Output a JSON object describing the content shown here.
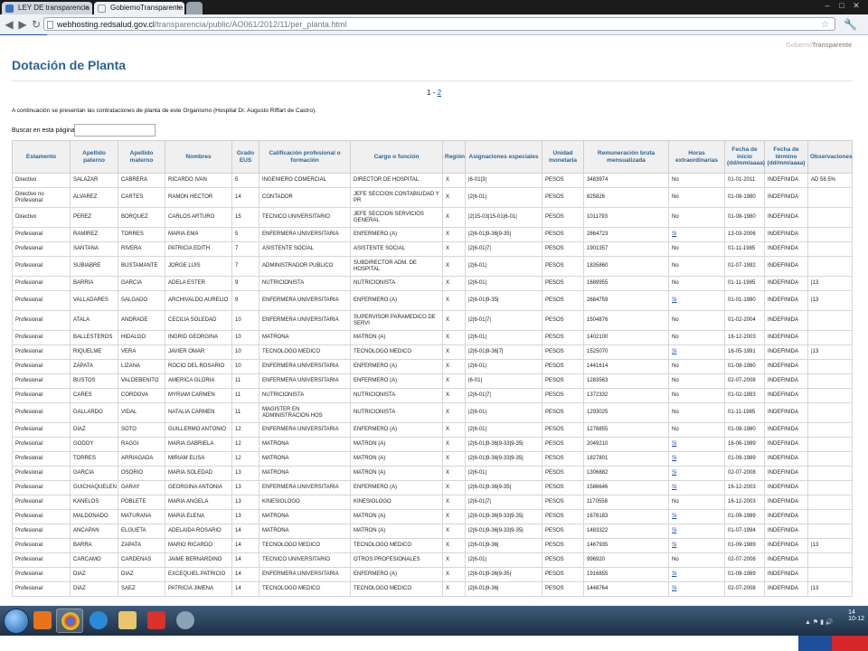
{
  "browser": {
    "tabs": [
      {
        "label": "LEY DE transparencia - Go"
      },
      {
        "label": "GobiernoTransparente - D"
      }
    ],
    "url_host": "webhosting.redsalud.gov.cl",
    "url_path": "/transparencia/public/AO061/2012/11/per_planta.html"
  },
  "page": {
    "brand_prefix": "Gobierno",
    "brand_suffix": "Transparente",
    "title": "Dotación de Planta",
    "pager_current": "1 - ",
    "pager_link": "2",
    "intro": "A continuación se presentan las contrataciones de planta de este Organismo (Hospital Dr. Augusto Riffart de Castro).",
    "search_label": "Buscar en esta página:",
    "search_value": ""
  },
  "table": {
    "headers": [
      "Estamento",
      "Apellido paterno",
      "Apellido materno",
      "Nombres",
      "Grado EUS",
      "Calificación profesional o formación",
      "Cargo o función",
      "Región",
      "Asignaciones especiales",
      "Unidad monetaria",
      "Remuneración bruta mensualizada",
      "Horas extraordinarias",
      "Fecha de inicio (dd/mm/aaaa)",
      "Fecha de término (dd/mm/aaaa)",
      "Observaciones"
    ],
    "rows": [
      [
        "Directivo",
        "SALAZAR",
        "CABRERA",
        "RICARDO IVAN",
        "5",
        "INGENIERO COMERCIAL",
        "DIRECTOR DE HOSPITAL",
        "X",
        "|6-01|3|",
        "PESOS",
        "3483974",
        "No",
        "01-01-2011",
        "INDEFINIDA",
        "AD 58.5%"
      ],
      [
        "Directivo no Profesional",
        "ALVAREZ",
        "CARTES",
        "RAMON HECTOR",
        "14",
        "CONTADOR",
        "JEFE SECCION CONTABILIDAD Y PR",
        "X",
        "|2|6-01|",
        "PESOS",
        "825826",
        "No",
        "01-08-1980",
        "INDEFINIDA",
        ""
      ],
      [
        "Directivo",
        "PEREZ",
        "BORQUEZ",
        "CARLOS ARTURO",
        "15",
        "TECNICO UNIVERSITARIO",
        "JEFE SECCION SERVICIOS GENERAL",
        "X",
        "|2|15-03|15-01|6-01|",
        "PESOS",
        "1011793",
        "No",
        "01-08-1980",
        "INDEFINIDA",
        ""
      ],
      [
        "Profesional",
        "RAMIREZ",
        "TORRES",
        "MARIA EMA",
        "5",
        "ENFERMERA UNIVERSITARIA",
        "ENFERMERO (A)",
        "X",
        "|2|6-01|9-36|9-35|",
        "PESOS",
        "2864723",
        "Si",
        "13-03-2006",
        "INDEFINIDA",
        ""
      ],
      [
        "Profesional",
        "SANTANA",
        "RIVERA",
        "PATRICIA EDITH",
        "7",
        "ASISTENTE SOCIAL",
        "ASISTENTE SOCIAL",
        "X",
        "|2|6-01|7|",
        "PESOS",
        "1901357",
        "No",
        "01-11-1985",
        "INDEFINIDA",
        ""
      ],
      [
        "Profesional",
        "SUBIABRE",
        "BUSTAMANTE",
        "JORGE LUIS",
        "7",
        "ADMINISTRADOR PUBLICO",
        "SUBDIRECTOR ADM. DE HOSPITAL",
        "X",
        "|2|6-01|",
        "PESOS",
        "1835860",
        "No",
        "01-07-1992",
        "INDEFINIDA",
        ""
      ],
      [
        "Profesional",
        "BARRIA",
        "GARCIA",
        "ADELA ESTER",
        "9",
        "NUTRICIONISTA",
        "NUTRICIONISTA",
        "X",
        "|2|6-01|",
        "PESOS",
        "1689955",
        "No",
        "01-11-1985",
        "INDEFINIDA",
        "|13"
      ],
      [
        "Profesional",
        "VALLADARES",
        "SALGADO",
        "ARCHIVALDO AURELIO",
        "9",
        "ENFERMERA UNIVERSITARIA",
        "ENFERMERO (A)",
        "X",
        "|2|6-01|9-35|",
        "PESOS",
        "2684759",
        "Si",
        "01-01-1980",
        "INDEFINIDA",
        "|13"
      ],
      [
        "Profesional",
        "ATALA",
        "ANDRADE",
        "CECILIA SOLEDAD",
        "10",
        "ENFERMERA UNIVERSITARIA",
        "SUPERVISOR PARAMEDICO DE SERVI",
        "X",
        "|2|6-01|7|",
        "PESOS",
        "1504876",
        "No",
        "01-02-2004",
        "INDEFINIDA",
        ""
      ],
      [
        "Profesional",
        "BALLESTEROS",
        "HIDALGO",
        "INGRID GEORGINA",
        "10",
        "MATRONA",
        "MATRON (A)",
        "X",
        "|2|6-01|",
        "PESOS",
        "1402100",
        "No",
        "16-12-2003",
        "INDEFINIDA",
        ""
      ],
      [
        "Profesional",
        "RIQUELME",
        "VERA",
        "JAVIER OMAR",
        "10",
        "TECNOLOGO MEDICO",
        "TECNOLOGO MEDICO",
        "X",
        "|2|6-01|9-36|7|",
        "PESOS",
        "1525070",
        "Si",
        "16-05-1991",
        "INDEFINIDA",
        "|13"
      ],
      [
        "Profesional",
        "ZAPATA",
        "LIZANA",
        "ROCIO DEL ROSARIO",
        "10",
        "ENFERMERA UNIVERSITARIA",
        "ENFERMERO (A)",
        "X",
        "|2|6-01|",
        "PESOS",
        "1441614",
        "No",
        "01-08-1980",
        "INDEFINIDA",
        ""
      ],
      [
        "Profesional",
        "BUSTOS",
        "VALDEBENITO",
        "AMERICA GLORIA",
        "11",
        "ENFERMERA UNIVERSITARIA",
        "ENFERMERO (A)",
        "X",
        "|6-01|",
        "PESOS",
        "1283563",
        "No",
        "02-07-2008",
        "INDEFINIDA",
        ""
      ],
      [
        "Profesional",
        "CARES",
        "CORDOVA",
        "MYRIAM CARMEN",
        "11",
        "NUTRICIONISTA",
        "NUTRICIONISTA",
        "X",
        "|2|6-01|7|",
        "PESOS",
        "1372332",
        "No",
        "01-02-1993",
        "INDEFINIDA",
        ""
      ],
      [
        "Profesional",
        "GALLARDO",
        "VIDAL",
        "NATALIA CARMEN",
        "11",
        "MAGISTER EN ADMINISTRACION HOS",
        "NUTRICIONISTA",
        "X",
        "|2|6-01|",
        "PESOS",
        "1293025",
        "No",
        "01-11-1985",
        "INDEFINIDA",
        ""
      ],
      [
        "Profesional",
        "DIAZ",
        "SOTO",
        "GUILLERMO ANTONIO",
        "12",
        "ENFERMERA UNIVERSITARIA",
        "ENFERMERO (A)",
        "X",
        "|2|6-01|",
        "PESOS",
        "1278855",
        "No",
        "01-08-1980",
        "INDEFINIDA",
        ""
      ],
      [
        "Profesional",
        "GODOY",
        "RAGGI",
        "MARIA GABRIELA",
        "12",
        "MATRONA",
        "MATRON (A)",
        "X",
        "|2|6-01|9-36|9-33|9-35|",
        "PESOS",
        "2049210",
        "Si",
        "16-06-1989",
        "INDEFINIDA",
        ""
      ],
      [
        "Profesional",
        "TORRES",
        "ARRIAGADA",
        "MIRIAM ELISA",
        "12",
        "MATRONA",
        "MATRON (A)",
        "X",
        "|2|6-01|9-36|9-33|9-35|",
        "PESOS",
        "1827801",
        "Si",
        "01-09-1989",
        "INDEFINIDA",
        ""
      ],
      [
        "Profesional",
        "GARCIA",
        "OSORIO",
        "MARIA SOLEDAD",
        "13",
        "MATRONA",
        "MATRON (A)",
        "X",
        "|2|6-01|",
        "PESOS",
        "1306882",
        "Si",
        "02-07-2008",
        "INDEFINIDA",
        ""
      ],
      [
        "Profesional",
        "GUICHAQUELEN",
        "GARAY",
        "GEORGINA ANTONIA",
        "13",
        "ENFERMERA UNIVERSITARIA",
        "ENFERMERO (A)",
        "X",
        "|2|6-01|9-36|9-35|",
        "PESOS",
        "1586646",
        "Si",
        "16-12-2003",
        "INDEFINIDA",
        ""
      ],
      [
        "Profesional",
        "KANELOS",
        "POBLETE",
        "MARIA ANGELA",
        "13",
        "KINESIOLOGO",
        "KINESIOLOGO",
        "X",
        "|2|6-01|7|",
        "PESOS",
        "1170558",
        "No",
        "16-12-2003",
        "INDEFINIDA",
        ""
      ],
      [
        "Profesional",
        "MALDONADO",
        "MATURANA",
        "MARIA ELENA",
        "13",
        "MATRONA",
        "MATRON (A)",
        "X",
        "|2|6-01|9-36|9-33|9-35|",
        "PESOS",
        "1678183",
        "Si",
        "01-09-1989",
        "INDEFINIDA",
        ""
      ],
      [
        "Profesional",
        "ANCAPAN",
        "ELGUETA",
        "ADELAIDA ROSARIO",
        "14",
        "MATRONA",
        "MATRON (A)",
        "X",
        "|2|6-01|9-36|9-33|9-35|",
        "PESOS",
        "1483322",
        "Si",
        "01-07-1994",
        "INDEFINIDA",
        ""
      ],
      [
        "Profesional",
        "BARRA",
        "ZAPATA",
        "MARIO RICARDO",
        "14",
        "TECNOLOGO MEDICO",
        "TECNOLOGO MEDICO",
        "X",
        "|2|6-01|9-36|",
        "PESOS",
        "1467935",
        "Si",
        "01-09-1989",
        "INDEFINIDA",
        "|13"
      ],
      [
        "Profesional",
        "CARCAMO",
        "CARDENAS",
        "JAIME BERNARDINO",
        "14",
        "TECNICO UNIVERSITARIO",
        "OTROS PROFESIONALES",
        "X",
        "|2|6-01|",
        "PESOS",
        "996920",
        "No",
        "02-07-2006",
        "INDEFINIDA",
        ""
      ],
      [
        "Profesional",
        "DIAZ",
        "DIAZ",
        "EXCEQUIEL PATRICIO",
        "14",
        "ENFERMERA UNIVERSITARIA",
        "ENFERMERO (A)",
        "X",
        "|2|6-01|9-36|9-35|",
        "PESOS",
        "1916855",
        "Si",
        "01-09-1989",
        "INDEFINIDA",
        ""
      ],
      [
        "Profesional",
        "DIAZ",
        "SAEZ",
        "PATRICIA JIMENA",
        "14",
        "TECNOLOGO MEDICO",
        "TECNOLOGO MEDICO",
        "X",
        "|2|6-01|9-36|",
        "PESOS",
        "1448764",
        "Si",
        "02-07-2008",
        "INDEFINIDA",
        "|13"
      ]
    ]
  },
  "taskbar": {
    "clock_time": "14",
    "clock_date": "10-12"
  }
}
